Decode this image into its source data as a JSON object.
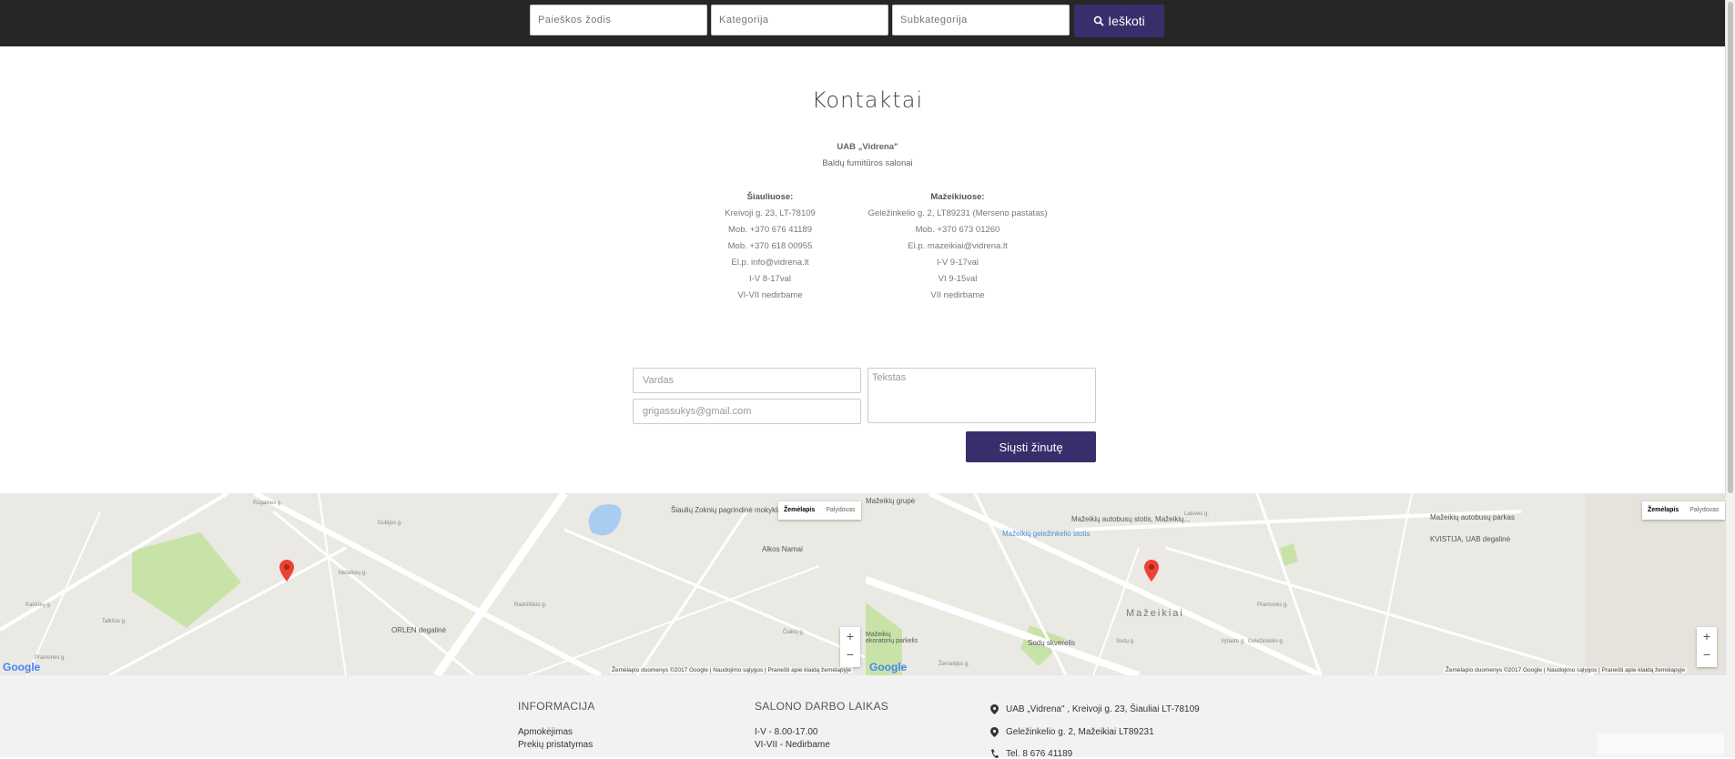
{
  "search": {
    "keyword_placeholder": "Paieškos žodis",
    "category_placeholder": "Kategorija",
    "subcategory_placeholder": "Subkategorija",
    "button_label": "Ieškoti"
  },
  "page": {
    "title": "Kontaktai"
  },
  "company": {
    "name": "UAB „Vidrena\"",
    "subtitle": "Baldų furnitūros salonai"
  },
  "siauliai": {
    "heading": "Šiauliuose:",
    "lines": [
      "Kreivoji g. 23, LT-78109",
      "Mob. +370 676 41189",
      "Mob. +370 618 00955",
      "El.p. info@vidrena.lt",
      "I-V 8-17val",
      "VI-VII nedirbame"
    ]
  },
  "mazeikiai": {
    "heading": "Mažeikiuose:",
    "lines": [
      "Geležinkelio g. 2, LT89231 (Merseno pastatas)",
      "Mob. +370 673 01260",
      "El.p. mazeikiai@vidrena.lt",
      "I-V 9-17val",
      "VI 9-15val",
      "VII nedirbame"
    ]
  },
  "form": {
    "name_placeholder": "Vardas",
    "email_value": "grigassukys@gmail.com",
    "text_placeholder": "Tekstas",
    "send_label": "Siųsti žinutę"
  },
  "map_left": {
    "toggle_map": "Žemėlapis",
    "toggle_satellite": "Palydovas",
    "footer_data": "Žemėlapio duomenys ©2017 Google",
    "footer_terms": "Naudojimo sąlygos",
    "footer_report": "Pranešti apie klaidą žemėlapyje",
    "pois": [
      "Šiaulių Zoknių pagrindinė mokykla",
      "Alkos Namai",
      "ORLEN degalinė"
    ],
    "streets": [
      "Rūgaines g.",
      "Dubijos g.",
      "Metalistų g.",
      "Kairiūkų g.",
      "Talkšos g.",
      "Pramonės g.",
      "Radviliškio g.",
      "Čiakių g."
    ]
  },
  "map_right": {
    "toggle_map": "Žemėlapis",
    "toggle_satellite": "Palydovas",
    "footer_data": "Žemėlapio duomenys ©2017 Google",
    "footer_terms": "Naudojimo sąlygos",
    "footer_report": "Pranešti apie klaidą žemėlapyje",
    "pois": [
      "Mažeikių autobusų stotis, Mažeikių...",
      "Mažeikių geležinkelio stotis",
      "Mažeikių autobusų parkas",
      "KVISTIJA, UAB degalinė",
      "Mažeikiai",
      "Sodų skverelis",
      "Mažeikių ekoratorių parkelis",
      "Mažeikių grupė"
    ],
    "streets": [
      "Laisvės g.",
      "Vytauto g.",
      "Pramonės g.",
      "Geležinkelio g.",
      "Sodų g.",
      "Žemaitijos g."
    ]
  },
  "footer": {
    "info_heading": "INFORMACIJA",
    "info_links": [
      "Apmokėjimas",
      "Prekių pristatymas"
    ],
    "hours_heading": "SALONO DARBO LAIKAS",
    "hours_lines": [
      "I-V - 8.00-17.00",
      "VI-VII - Nedirbame"
    ],
    "contacts": [
      "UAB „Vidrena\" , Kreivoji g. 23, Šiauliai LT-78109",
      "Geležinkelio g. 2, Mažeikiai LT89231",
      "Tel. 8 676 41189"
    ]
  },
  "colors": {
    "accent": "#3a2d6b",
    "topbar": "#262626",
    "footer_bg": "#f2f2f2"
  }
}
